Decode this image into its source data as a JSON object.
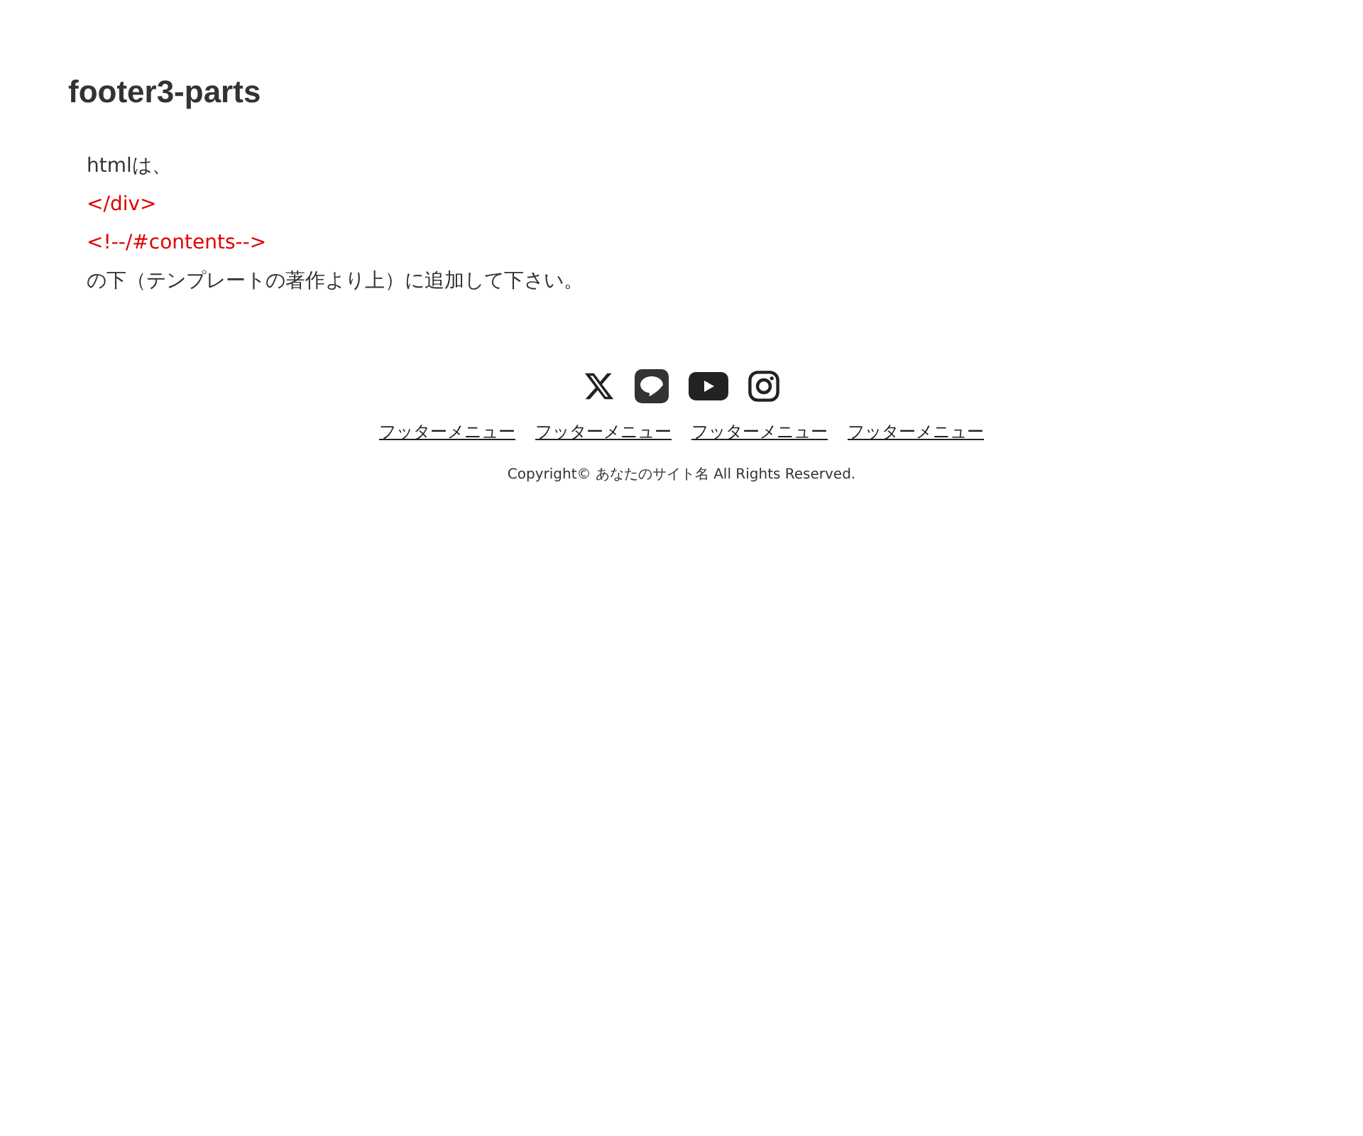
{
  "heading": "footer3-parts",
  "lines": [
    {
      "kind": "text",
      "text": "htmlは、"
    },
    {
      "kind": "code",
      "text": "</div>"
    },
    {
      "kind": "code",
      "text": "<!--/#contents-->"
    },
    {
      "kind": "text",
      "text": "の下（テンプレートの著作より上）に追加して下さい。"
    }
  ],
  "footer": {
    "social": [
      {
        "kind": "x"
      },
      {
        "kind": "line"
      },
      {
        "kind": "youtube"
      },
      {
        "kind": "instagram"
      }
    ],
    "menu": [
      "フッターメニュー",
      "フッターメニュー",
      "フッターメニュー",
      "フッターメニュー"
    ],
    "copyright": "Copyright© あなたのサイト名 All Rights Reserved."
  }
}
